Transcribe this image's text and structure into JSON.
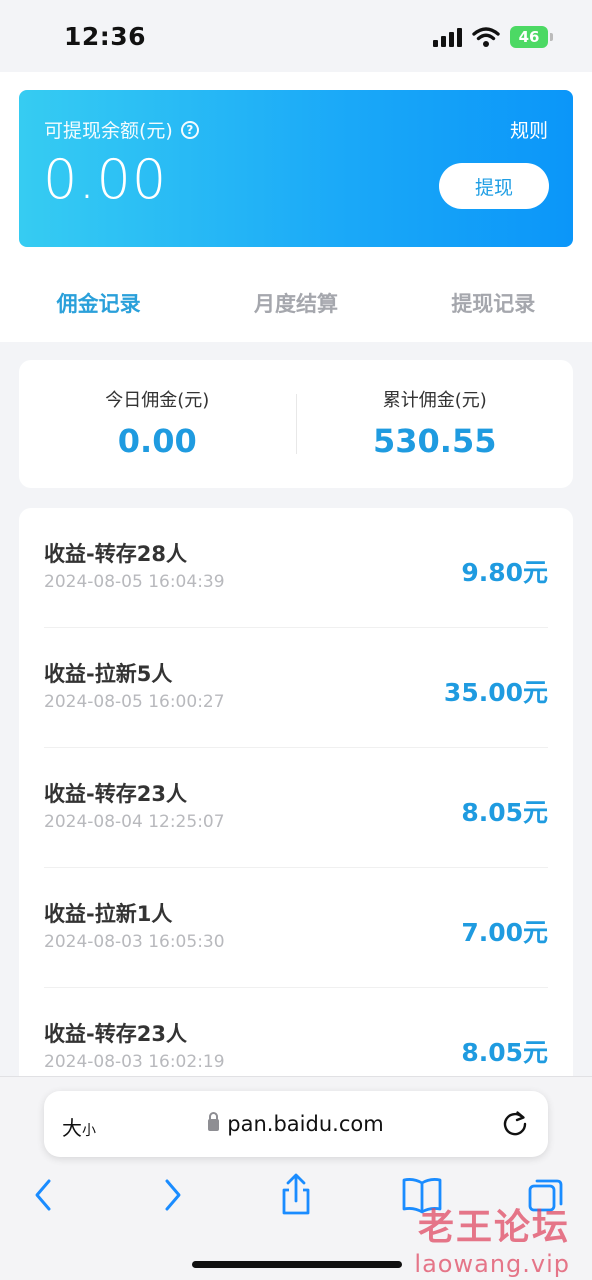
{
  "status_bar": {
    "time": "12:36",
    "battery": "46"
  },
  "balance_card": {
    "label": "可提现余额(元)",
    "help_icon": "?",
    "rules": "规则",
    "amount": "0.00",
    "withdraw": "提现"
  },
  "tabs": [
    {
      "label": "佣金记录",
      "active": true
    },
    {
      "label": "月度结算",
      "active": false
    },
    {
      "label": "提现记录",
      "active": false
    }
  ],
  "stats": {
    "today_label": "今日佣金(元)",
    "today_value": "0.00",
    "total_label": "累计佣金(元)",
    "total_value": "530.55"
  },
  "records": [
    {
      "title": "收益-转存28人",
      "time": "2024-08-05 16:04:39",
      "amount": "9.80元"
    },
    {
      "title": "收益-拉新5人",
      "time": "2024-08-05 16:00:27",
      "amount": "35.00元"
    },
    {
      "title": "收益-转存23人",
      "time": "2024-08-04 12:25:07",
      "amount": "8.05元"
    },
    {
      "title": "收益-拉新1人",
      "time": "2024-08-03 16:05:30",
      "amount": "7.00元"
    },
    {
      "title": "收益-转存23人",
      "time": "2024-08-03 16:02:19",
      "amount": "8.05元"
    }
  ],
  "browser": {
    "text_size_big": "大",
    "text_size_small": "小",
    "url": "pan.baidu.com"
  },
  "watermark": {
    "line1": "老王论坛",
    "line2": "laowang.vip"
  },
  "colors": {
    "accent": "#1f9be0",
    "card_gradient_start": "#36ccf2",
    "card_gradient_end": "#0b96f9"
  }
}
